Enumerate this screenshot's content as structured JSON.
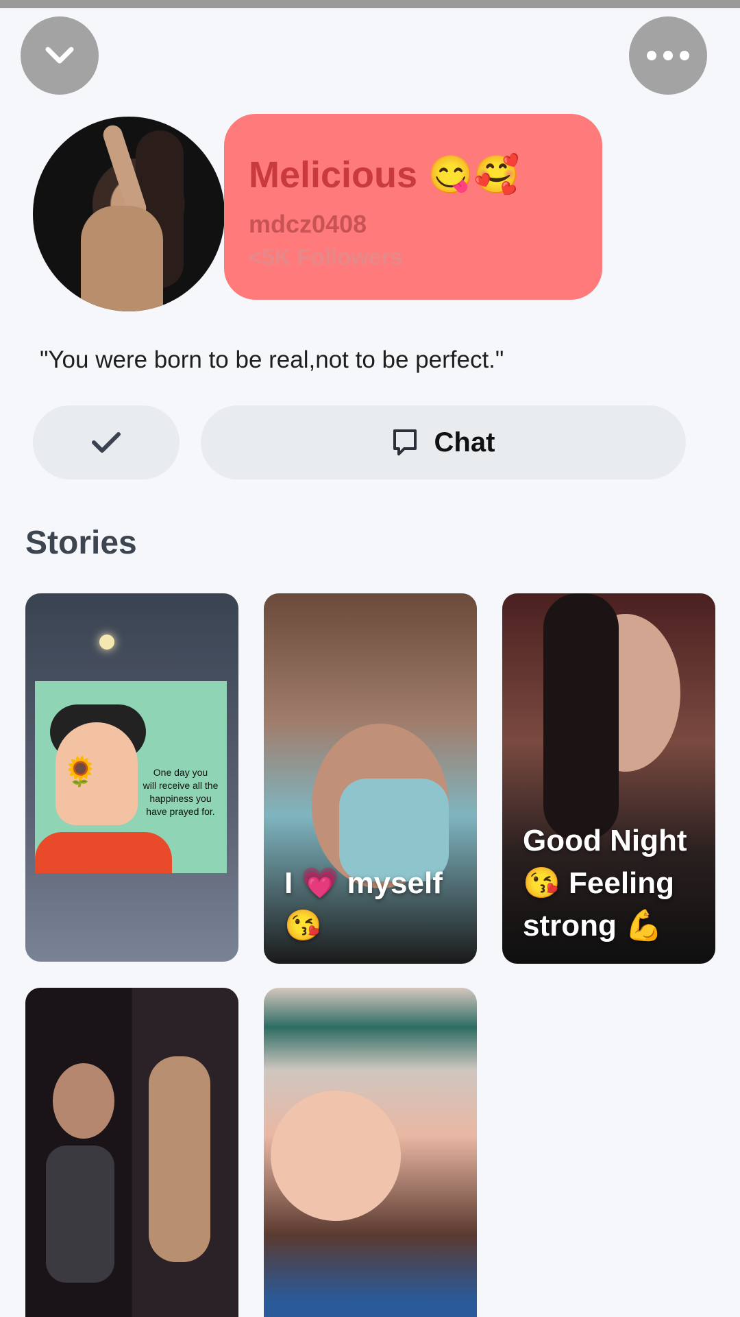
{
  "header": {
    "collapse_icon": "chevron-down-icon",
    "more_icon": "more-horizontal-icon"
  },
  "profile": {
    "display_name": "Melicious 😋🥰",
    "username": "mdcz0408",
    "followers": "<5K Followers",
    "bio": "\"You were born to be real,not to be perfect.\"",
    "card_color": "#ff7b7b"
  },
  "actions": {
    "check_icon": "checkmark-icon",
    "chat_icon": "chat-bubble-icon",
    "chat_label": "Chat"
  },
  "stories": {
    "title": "Stories",
    "items": [
      {
        "caption": "",
        "poster_lines": [
          "One day you",
          "will receive all the",
          "happiness you",
          "have prayed for."
        ]
      },
      {
        "caption": "I 💗 myself 😘"
      },
      {
        "caption": "Good Night 😘 Feeling strong 💪"
      },
      {
        "caption": ""
      },
      {
        "caption": ""
      }
    ]
  }
}
